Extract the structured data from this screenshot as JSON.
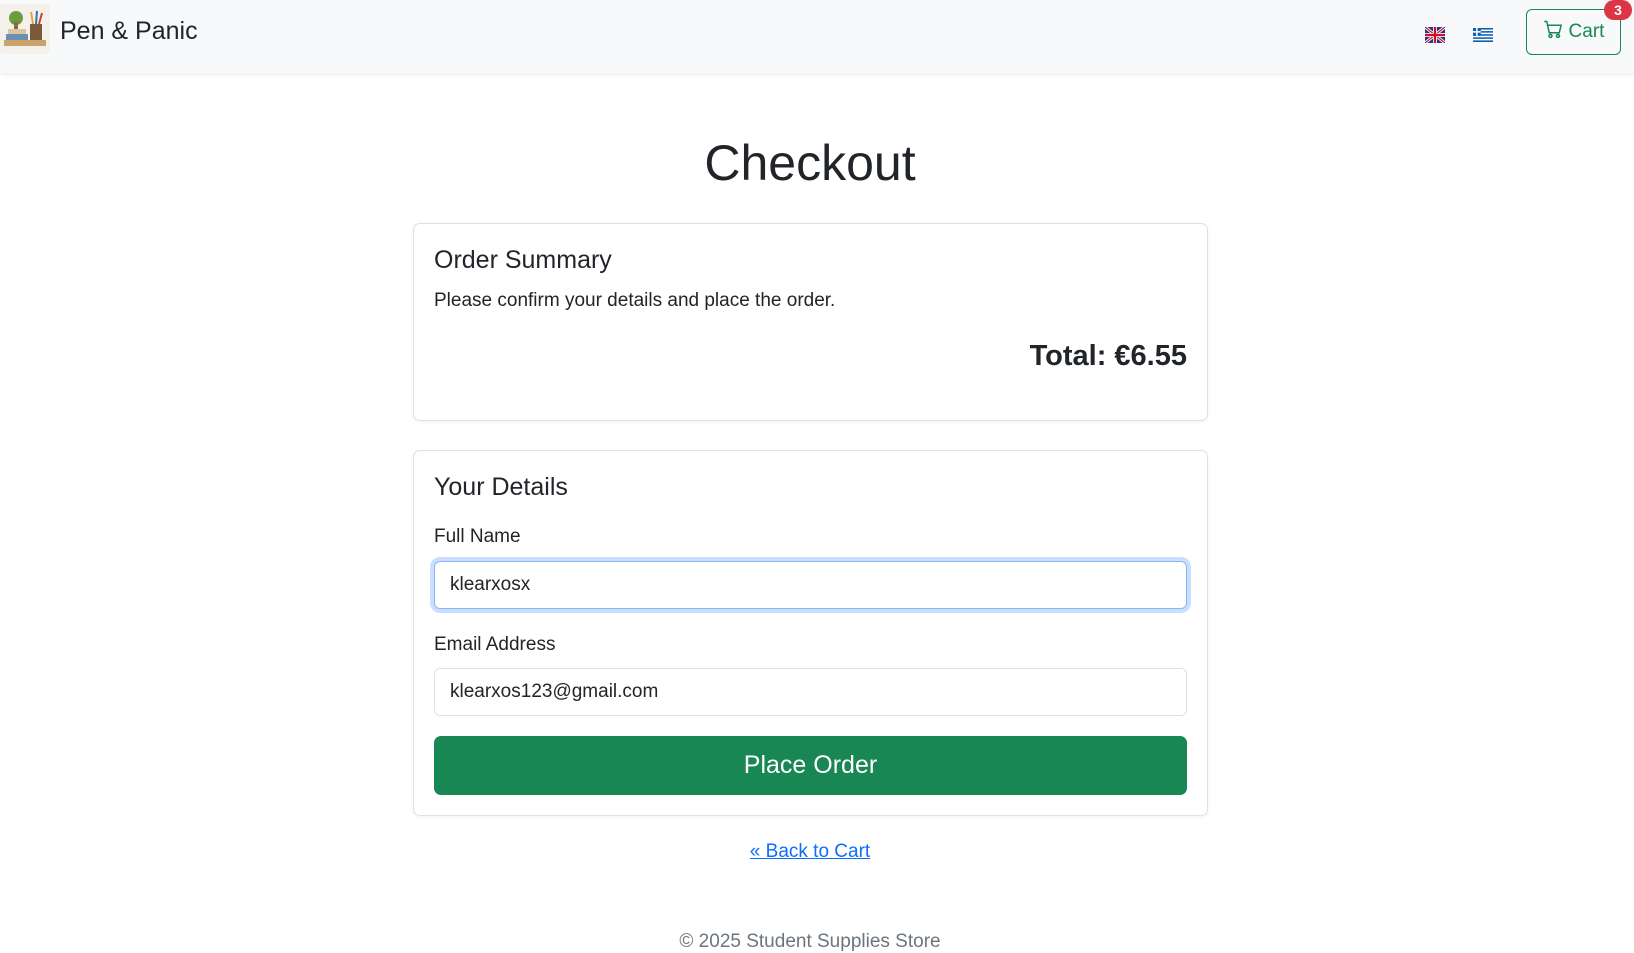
{
  "navbar": {
    "brand_name": "Pen & Panic",
    "logo_icon": "brand-logo-stationery",
    "languages": [
      {
        "code": "en",
        "icon": "uk-flag-icon"
      },
      {
        "code": "gr",
        "icon": "greek-flag-icon"
      }
    ],
    "cart": {
      "label": "Cart",
      "icon": "cart-icon",
      "count": "3"
    }
  },
  "page": {
    "title": "Checkout"
  },
  "summary": {
    "title": "Order Summary",
    "text": "Please confirm your details and place the order.",
    "total": "Total: €6.55"
  },
  "details": {
    "title": "Your Details",
    "name_label": "Full Name",
    "name_value": "klearxosx",
    "email_label": "Email Address",
    "email_value": "klearxos123@gmail.com",
    "submit_label": "Place Order"
  },
  "back_link": "« Back to Cart",
  "footer": "© 2025 Student Supplies Store",
  "colors": {
    "accent": "#198754",
    "badge": "#dc3545",
    "link": "#0d6efd",
    "navbar_bg": "#f8f9fa",
    "focus_ring": "#86b7fe"
  }
}
